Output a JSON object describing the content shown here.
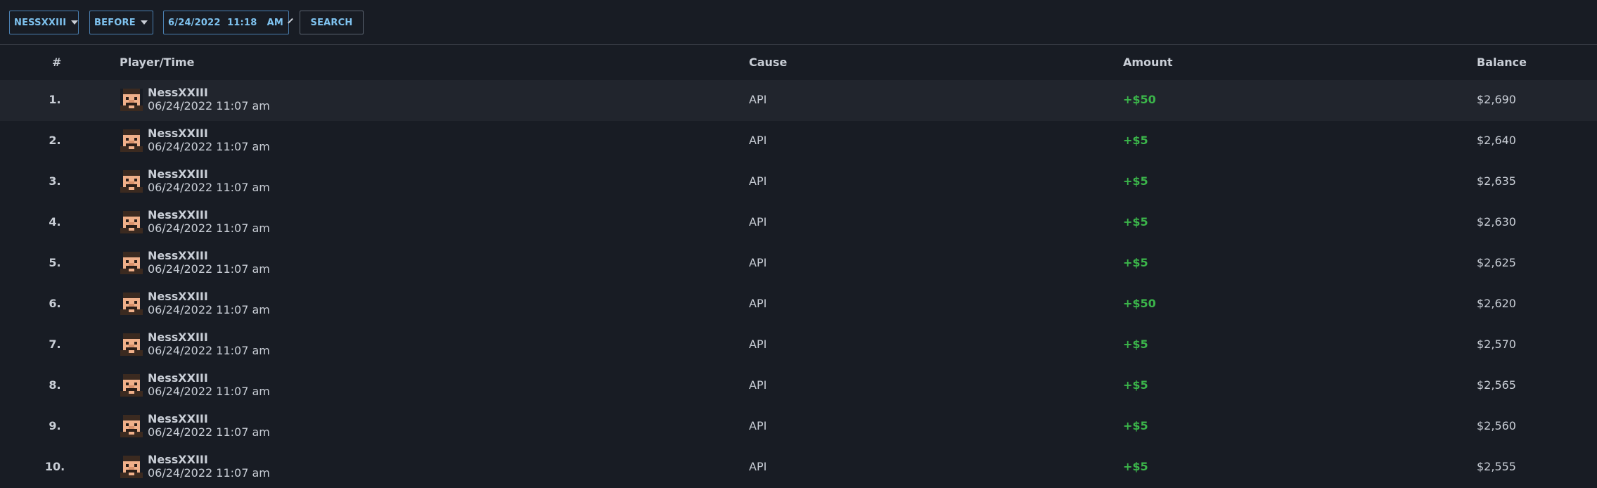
{
  "filters": {
    "player": "NESSXXIII",
    "mode": "BEFORE",
    "datetime": "6/24/2022  11:18   AM",
    "search_label": "SEARCH"
  },
  "table": {
    "headers": {
      "num": "#",
      "player": "Player/Time",
      "cause": "Cause",
      "amount": "Amount",
      "balance": "Balance"
    },
    "rows": [
      {
        "num": "1.",
        "player": "NessXXIII",
        "time": "06/24/2022 11:07 am",
        "cause": "API",
        "amount": "+$50",
        "balance": "$2,690"
      },
      {
        "num": "2.",
        "player": "NessXXIII",
        "time": "06/24/2022 11:07 am",
        "cause": "API",
        "amount": "+$5",
        "balance": "$2,640"
      },
      {
        "num": "3.",
        "player": "NessXXIII",
        "time": "06/24/2022 11:07 am",
        "cause": "API",
        "amount": "+$5",
        "balance": "$2,635"
      },
      {
        "num": "4.",
        "player": "NessXXIII",
        "time": "06/24/2022 11:07 am",
        "cause": "API",
        "amount": "+$5",
        "balance": "$2,630"
      },
      {
        "num": "5.",
        "player": "NessXXIII",
        "time": "06/24/2022 11:07 am",
        "cause": "API",
        "amount": "+$5",
        "balance": "$2,625"
      },
      {
        "num": "6.",
        "player": "NessXXIII",
        "time": "06/24/2022 11:07 am",
        "cause": "API",
        "amount": "+$50",
        "balance": "$2,620"
      },
      {
        "num": "7.",
        "player": "NessXXIII",
        "time": "06/24/2022 11:07 am",
        "cause": "API",
        "amount": "+$5",
        "balance": "$2,570"
      },
      {
        "num": "8.",
        "player": "NessXXIII",
        "time": "06/24/2022 11:07 am",
        "cause": "API",
        "amount": "+$5",
        "balance": "$2,565"
      },
      {
        "num": "9.",
        "player": "NessXXIII",
        "time": "06/24/2022 11:07 am",
        "cause": "API",
        "amount": "+$5",
        "balance": "$2,560"
      },
      {
        "num": "10.",
        "player": "NessXXIII",
        "time": "06/24/2022 11:07 am",
        "cause": "API",
        "amount": "+$5",
        "balance": "$2,555"
      }
    ]
  },
  "colors": {
    "background": "#181c24",
    "highlight_row": "#21252d",
    "accent": "#7fc3f0",
    "positive": "#3bb54a"
  },
  "icons": {
    "avatar": "player-skin-avatar-icon",
    "dropdown": "caret-down-icon",
    "date_dropdown": "chevron-down-icon"
  }
}
